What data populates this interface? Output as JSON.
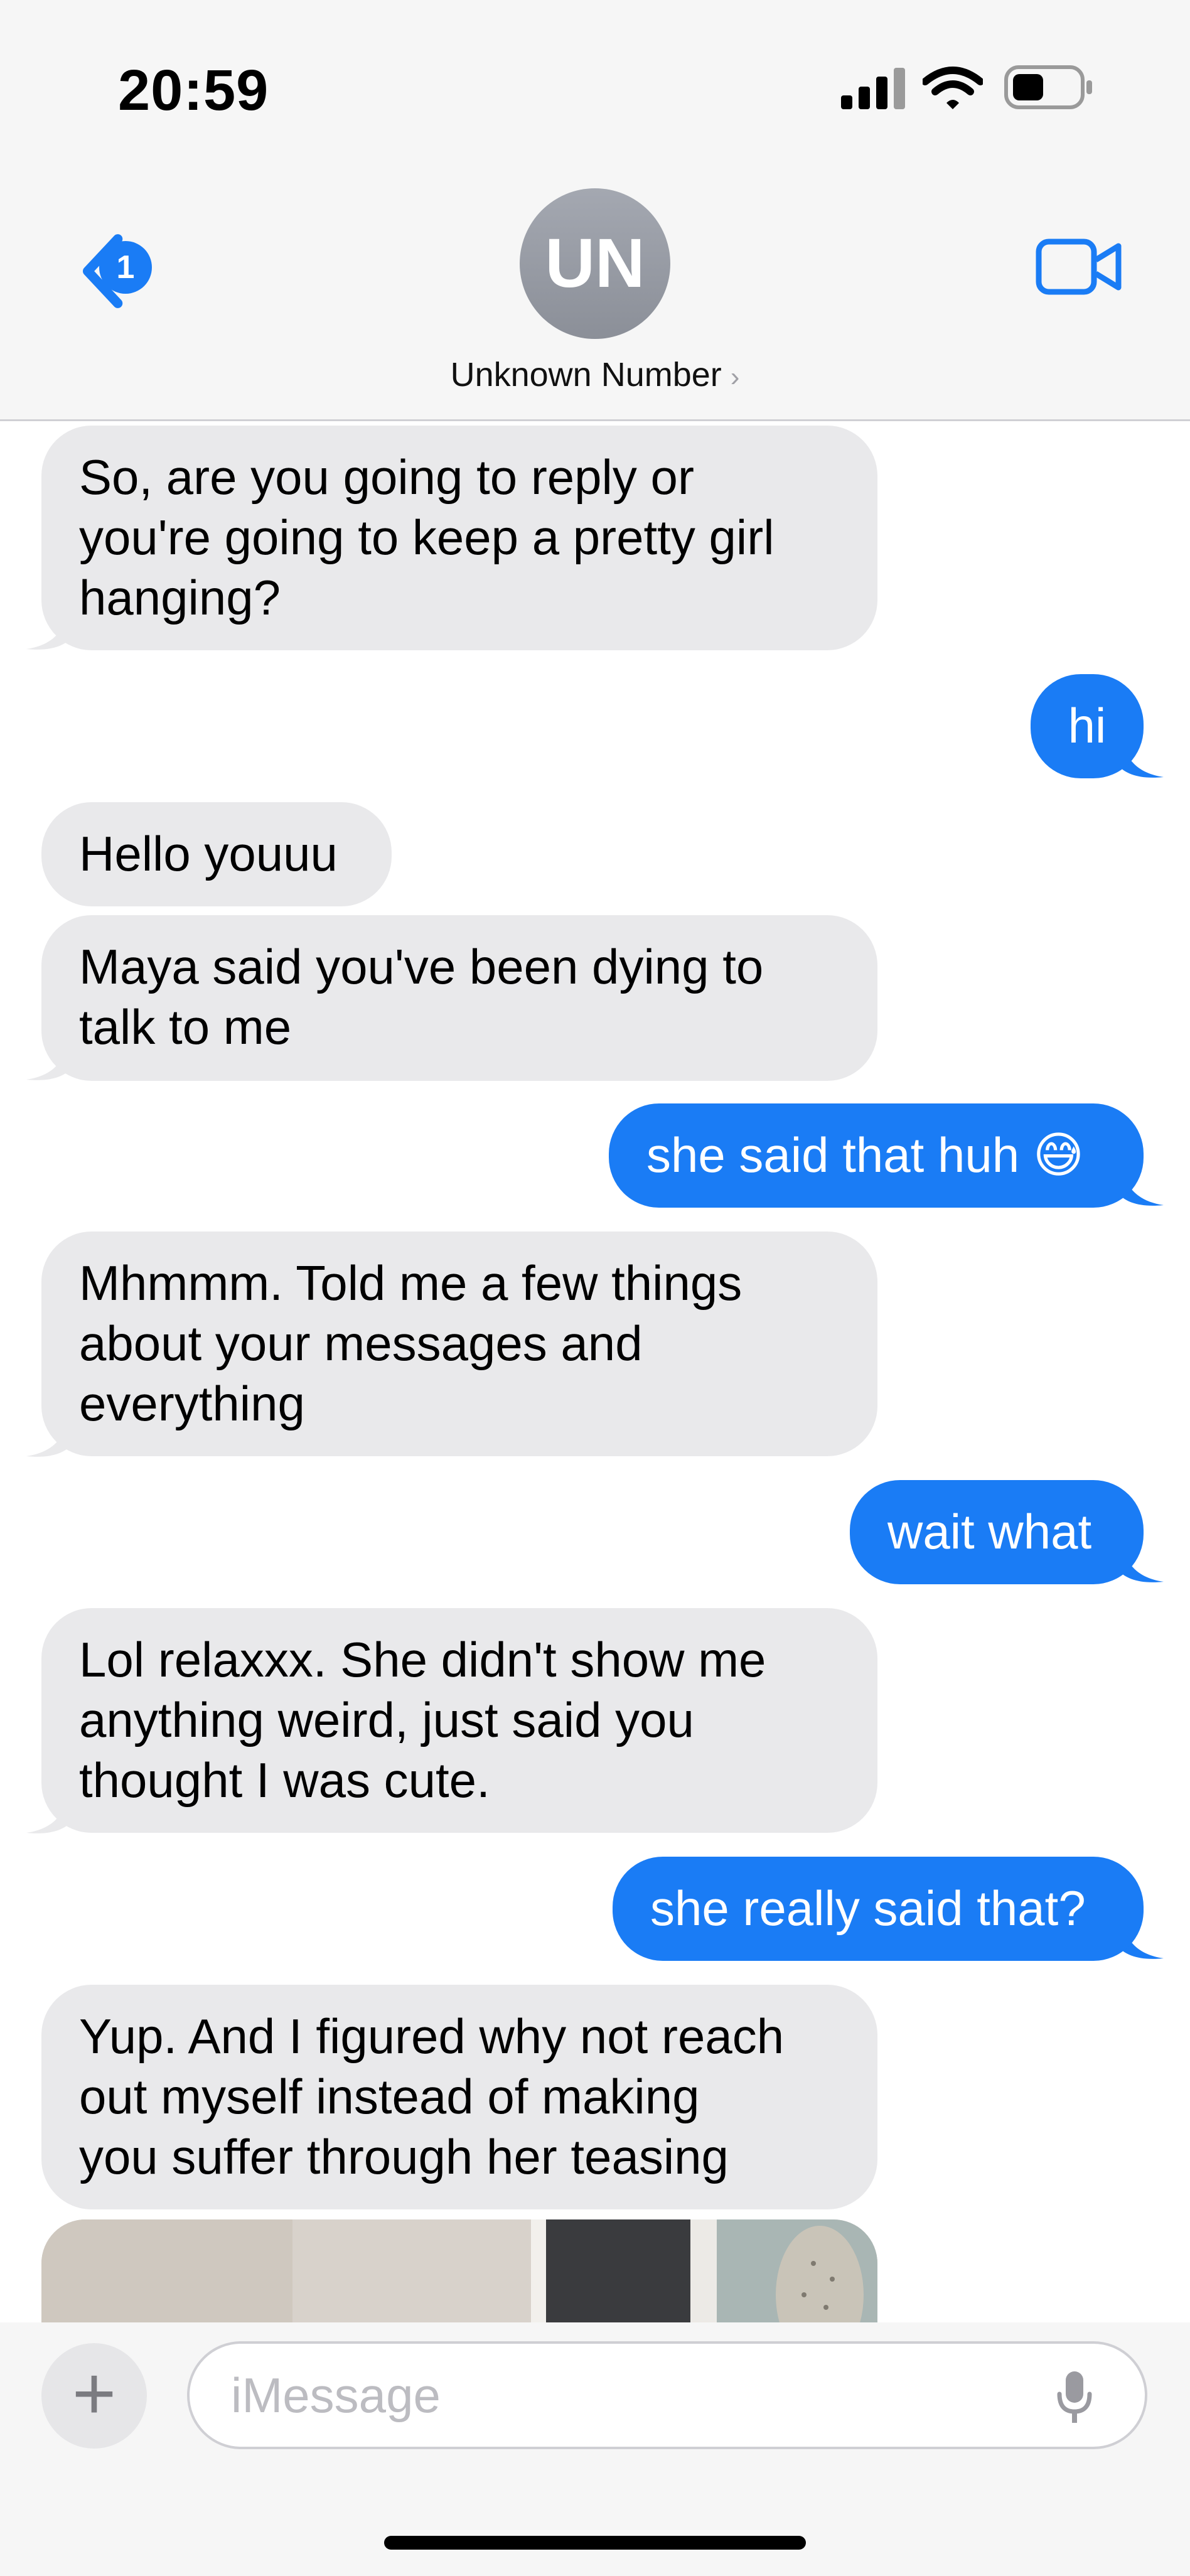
{
  "status": {
    "time": "20:59"
  },
  "nav": {
    "back_badge": "1",
    "avatar_initials": "UN",
    "contact_name": "Unknown Number",
    "contact_chevron": "›"
  },
  "messages": [
    {
      "from": "them",
      "text": "So, are you going to reply or\nyou're going to keep a pretty girl\nhanging?"
    },
    {
      "from": "me",
      "text": "hi"
    },
    {
      "from": "them",
      "text": "Hello youuu"
    },
    {
      "from": "them",
      "text": "Maya said you've been dying to\ntalk to me"
    },
    {
      "from": "me",
      "text": "she said that huh 😅"
    },
    {
      "from": "them",
      "text": "Mhmmm. Told me a few things\nabout your messages and\neverything"
    },
    {
      "from": "me",
      "text": "wait what"
    },
    {
      "from": "them",
      "text": "Lol relaxxx. She didn't show me\nanything weird, just said you\nthought I was cute."
    },
    {
      "from": "me",
      "text": "she really said that?"
    },
    {
      "from": "them",
      "text": "Yup. And I figured why not reach\nout myself instead of making\nyou suffer through her teasing"
    }
  ],
  "composer": {
    "plus": "+",
    "placeholder": "iMessage"
  },
  "icons": {
    "back": "chevron-left-icon",
    "video": "video-camera-icon",
    "signal": "cellular-signal-icon",
    "wifi": "wifi-icon",
    "battery": "battery-icon",
    "mic": "microphone-icon"
  },
  "colors": {
    "accent": "#1a7cf5",
    "incoming_bubble": "#e9e9eb",
    "outgoing_bubble": "#1a7cf5"
  }
}
